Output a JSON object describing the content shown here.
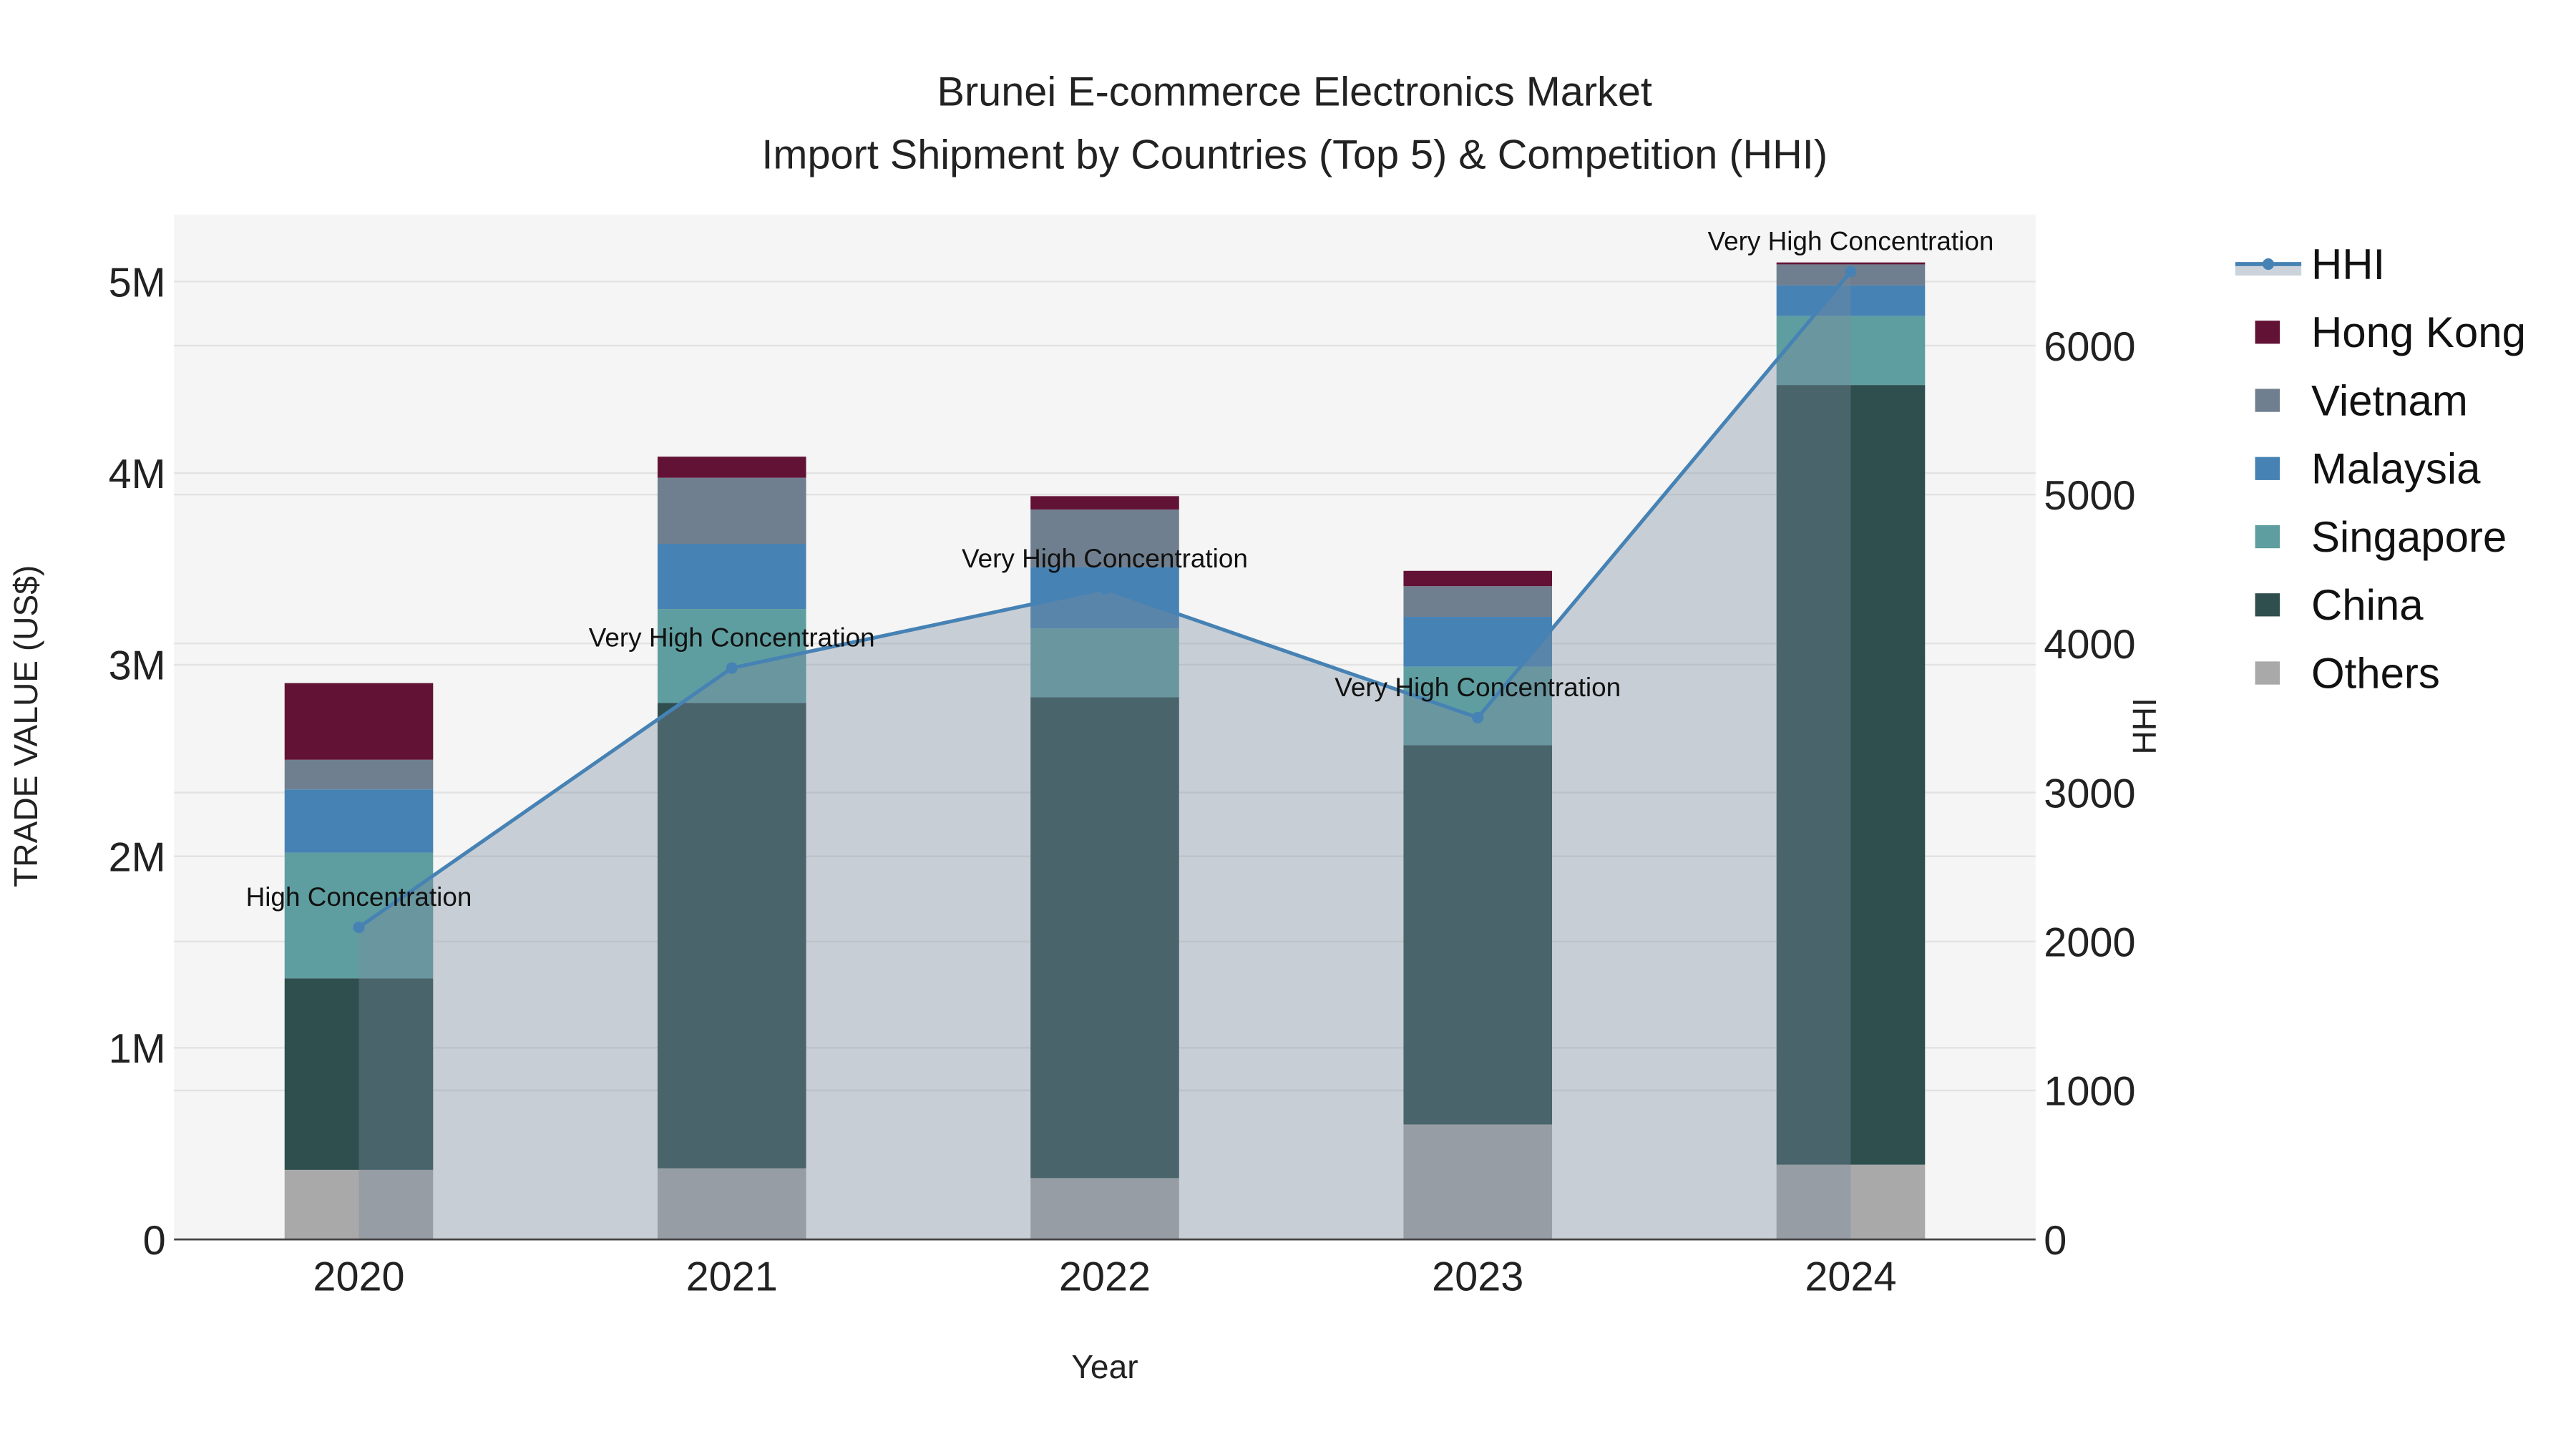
{
  "chart_data": {
    "type": "bar",
    "title_line1": "Brunei E-commerce Electronics Market",
    "title_line2": "Import Shipment by Countries (Top 5) & Competition (HHI)",
    "xlabel": "Year",
    "ylabel": "TRADE VALUE (US$)",
    "y2label": "HHI",
    "categories": [
      "2020",
      "2021",
      "2022",
      "2023",
      "2024"
    ],
    "ylim": [
      0,
      5350000
    ],
    "y2lim": [
      0,
      6880
    ],
    "yticks": [
      {
        "v": 0,
        "label": "0"
      },
      {
        "v": 1000000,
        "label": "1M"
      },
      {
        "v": 2000000,
        "label": "2M"
      },
      {
        "v": 3000000,
        "label": "3M"
      },
      {
        "v": 4000000,
        "label": "4M"
      },
      {
        "v": 5000000,
        "label": "5M"
      }
    ],
    "y2ticks": [
      {
        "v": 0,
        "label": "0"
      },
      {
        "v": 1000,
        "label": "1000"
      },
      {
        "v": 2000,
        "label": "2000"
      },
      {
        "v": 3000,
        "label": "3000"
      },
      {
        "v": 4000,
        "label": "4000"
      },
      {
        "v": 5000,
        "label": "5000"
      },
      {
        "v": 6000,
        "label": "6000"
      }
    ],
    "stacked": true,
    "series": [
      {
        "name": "Others",
        "color": "#a9a9a9",
        "values": [
          363000,
          371000,
          320000,
          600000,
          390000
        ]
      },
      {
        "name": "China",
        "color": "#2f4f4f",
        "values": [
          1000000,
          2430000,
          2510000,
          1980000,
          4070000
        ]
      },
      {
        "name": "Singapore",
        "color": "#5f9ea0",
        "values": [
          656000,
          490000,
          360000,
          410000,
          360000
        ]
      },
      {
        "name": "Malaysia",
        "color": "#4682b4",
        "values": [
          330000,
          340000,
          320000,
          260000,
          160000
        ]
      },
      {
        "name": "Vietnam",
        "color": "#6f7f8f",
        "values": [
          155000,
          345000,
          300000,
          160000,
          110000
        ]
      },
      {
        "name": "Hong Kong",
        "color": "#621335",
        "values": [
          400000,
          110000,
          70000,
          80000,
          10000
        ]
      }
    ],
    "hhi": {
      "name": "HHI",
      "color": "#4682b4",
      "values": [
        2095,
        3836,
        4368,
        3503,
        6497
      ],
      "annotations": [
        "High Concentration",
        "Very High Concentration",
        "Very High Concentration",
        "Very High Concentration",
        "Very High Concentration"
      ]
    },
    "legend": {
      "placement": "right",
      "order": [
        "HHI",
        "Hong Kong",
        "Vietnam",
        "Malaysia",
        "Singapore",
        "China",
        "Others"
      ]
    },
    "grid": true
  }
}
